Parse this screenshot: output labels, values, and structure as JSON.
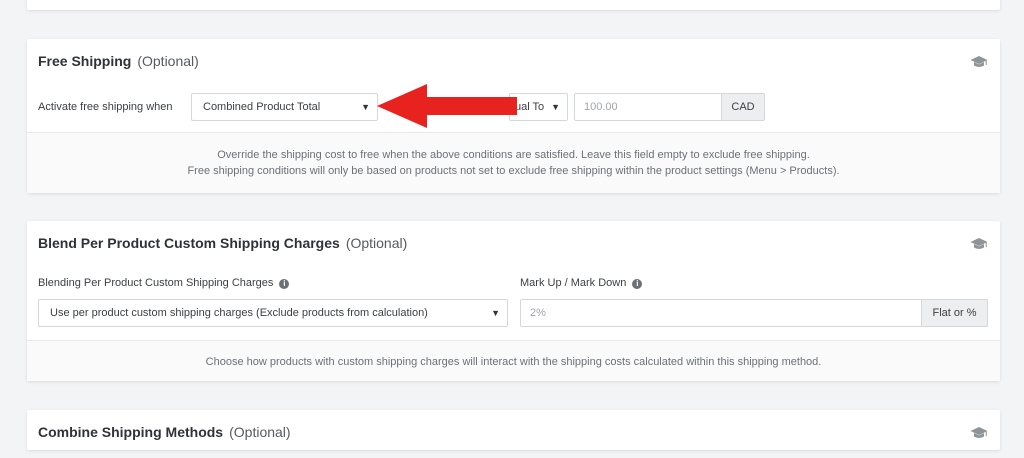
{
  "free_shipping": {
    "title": "Free Shipping",
    "optional": "(Optional)",
    "activate_label": "Activate free shipping when",
    "condition_select": "Combined Product Total",
    "operator_select": "ual To",
    "amount_placeholder": "100.00",
    "currency": "CAD",
    "note_line1": "Override the shipping cost to free when the above conditions are satisfied. Leave this field empty to exclude free shipping.",
    "note_line2": "Free shipping conditions will only be based on products not set to exclude free shipping within the product settings (Menu > Products)."
  },
  "blend": {
    "title": "Blend Per Product Custom Shipping Charges",
    "optional": "(Optional)",
    "blending_label": "Blending Per Product Custom Shipping Charges",
    "blending_select": "Use per product custom shipping charges (Exclude products from calculation)",
    "markup_label": "Mark Up / Mark Down",
    "markup_placeholder": "2%",
    "markup_addon": "Flat or %",
    "note": "Choose how products with custom shipping charges will interact with the shipping costs calculated within this shipping method."
  },
  "combine": {
    "title": "Combine Shipping Methods",
    "optional": "(Optional)"
  },
  "icons": {
    "section_help": "graduation-cap-icon",
    "info": "info-circle-icon",
    "dropdown": "caret-down-icon",
    "annotation": "red-arrow-icon"
  },
  "colors": {
    "annotation_arrow": "#e8231f"
  }
}
